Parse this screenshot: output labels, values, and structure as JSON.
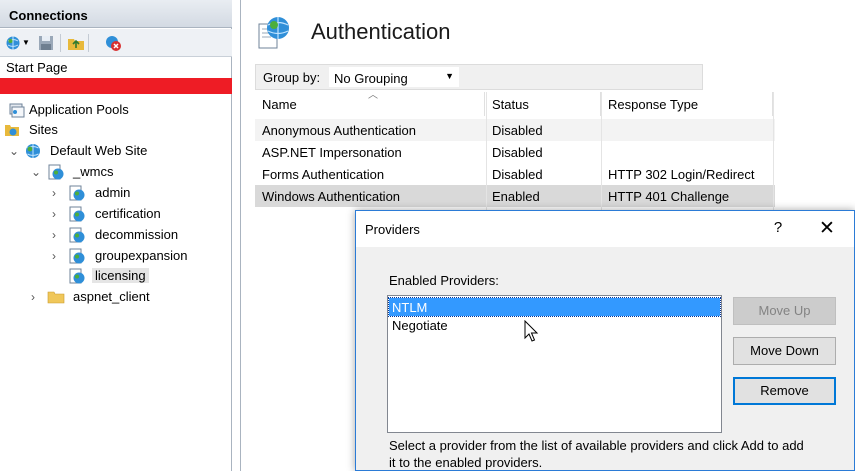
{
  "connections": {
    "header": "Connections",
    "start_page": "Start Page",
    "tree": [
      {
        "label": "Application Pools"
      },
      {
        "label": "Sites"
      },
      {
        "label": "Default Web Site"
      },
      {
        "label": "_wmcs"
      },
      {
        "label": "admin"
      },
      {
        "label": "certification"
      },
      {
        "label": "decommission"
      },
      {
        "label": "groupexpansion"
      },
      {
        "label": "licensing"
      },
      {
        "label": "aspnet_client"
      }
    ]
  },
  "main": {
    "title": "Authentication",
    "group_by_label": "Group by:",
    "group_by_value": "No Grouping",
    "columns": [
      "Name",
      "Status",
      "Response Type"
    ],
    "rows": [
      {
        "name": "Anonymous Authentication",
        "status": "Disabled",
        "response": ""
      },
      {
        "name": "ASP.NET Impersonation",
        "status": "Disabled",
        "response": ""
      },
      {
        "name": "Forms Authentication",
        "status": "Disabled",
        "response": "HTTP 302 Login/Redirect"
      },
      {
        "name": "Windows Authentication",
        "status": "Enabled",
        "response": "HTTP 401 Challenge"
      }
    ]
  },
  "dialog": {
    "title": "Providers",
    "help": "?",
    "close": "✕",
    "enabled_label": "Enabled Providers:",
    "providers": [
      "NTLM",
      "Negotiate"
    ],
    "move_up": "Move Up",
    "move_down": "Move Down",
    "remove": "Remove",
    "hint": "Select a provider from the list of available providers and click Add to add it to the enabled providers."
  },
  "colors": {
    "selection": "#3399ff",
    "redaction": "#ee1c25",
    "accent": "#0078d7"
  }
}
